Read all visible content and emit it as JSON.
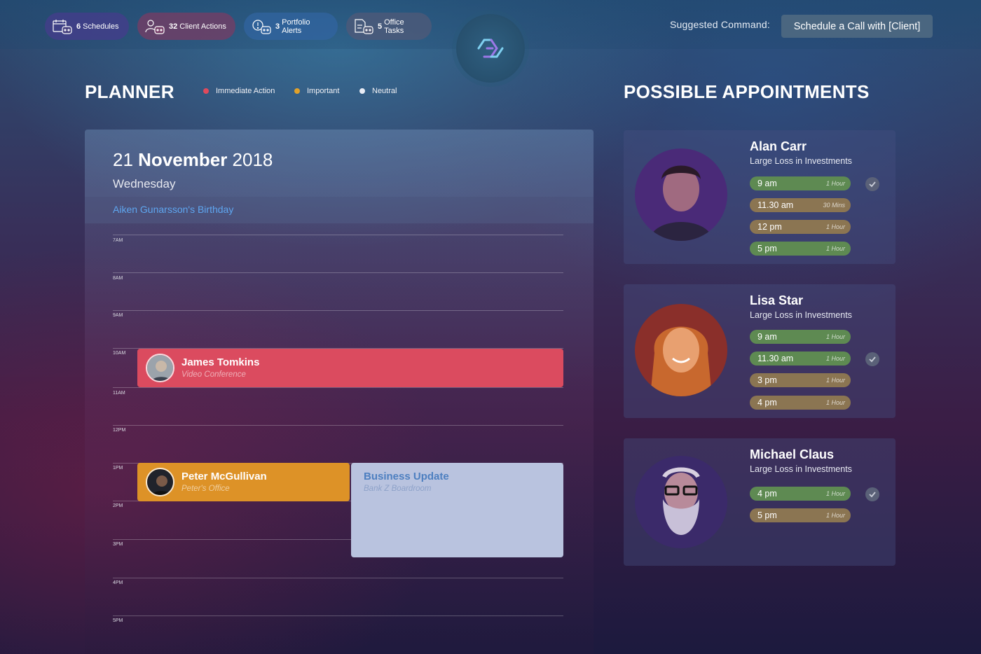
{
  "topbar": {
    "pills": [
      {
        "count": "6",
        "label": "Schedules",
        "icon": "calendar-bot-icon"
      },
      {
        "count": "32",
        "label": "Client Actions",
        "icon": "people-bot-icon"
      },
      {
        "count": "3",
        "label": "Portfolio Alerts",
        "icon": "alert-bot-icon"
      },
      {
        "count": "5",
        "label": "Office Tasks",
        "icon": "document-bot-icon"
      }
    ],
    "suggested_label": "Suggested  Command:",
    "suggested_command": "Schedule a Call with [Client]"
  },
  "planner": {
    "title": "PLANNER",
    "legend": [
      {
        "label": "Immediate Action",
        "color": "#e04a5c"
      },
      {
        "label": "Important",
        "color": "#e1a12a"
      },
      {
        "label": "Neutral",
        "color": "#e8ecf5"
      }
    ],
    "date_day": "21",
    "date_month": "November",
    "date_year": "2018",
    "weekday": "Wednesday",
    "all_day_event": "Aiken Gunarsson's Birthday",
    "hours": [
      "7AM",
      "8AM",
      "9AM",
      "10AM",
      "11AM",
      "12PM",
      "1PM",
      "2PM",
      "3PM",
      "4PM",
      "5PM"
    ],
    "events": [
      {
        "name": "James Tomkins",
        "subtitle": "Video Conference",
        "color": "#db4b5f"
      },
      {
        "name": "Peter McGullivan",
        "subtitle": "Peter's Office",
        "color": "#dd9227"
      },
      {
        "name": "Business Update",
        "subtitle": "Bank Z Boardroom",
        "color": "#b9c3df"
      }
    ]
  },
  "appointments": {
    "title": "POSSIBLE APPOINTMENTS",
    "cards": [
      {
        "name": "Alan Carr",
        "reason": "Large Loss in Investments",
        "slots": [
          {
            "time": "9 am",
            "duration": "1 Hour",
            "status": "green"
          },
          {
            "time": "11.30 am",
            "duration": "30 Mins",
            "status": "brown"
          },
          {
            "time": "12 pm",
            "duration": "1 Hour",
            "status": "brown"
          },
          {
            "time": "5 pm",
            "duration": "1 Hour",
            "status": "green"
          }
        ]
      },
      {
        "name": "Lisa Star",
        "reason": "Large Loss in Investments",
        "slots": [
          {
            "time": "9 am",
            "duration": "1 Hour",
            "status": "green"
          },
          {
            "time": "11.30 am",
            "duration": "1 Hour",
            "status": "green"
          },
          {
            "time": "3 pm",
            "duration": "1 Hour",
            "status": "brown"
          },
          {
            "time": "4 pm",
            "duration": "1 Hour",
            "status": "brown"
          }
        ]
      },
      {
        "name": "Michael Claus",
        "reason": "Large Loss in Investments",
        "slots": [
          {
            "time": "4 pm",
            "duration": "1 Hour",
            "status": "green"
          },
          {
            "time": "5 pm",
            "duration": "1 Hour",
            "status": "brown"
          }
        ]
      }
    ]
  }
}
